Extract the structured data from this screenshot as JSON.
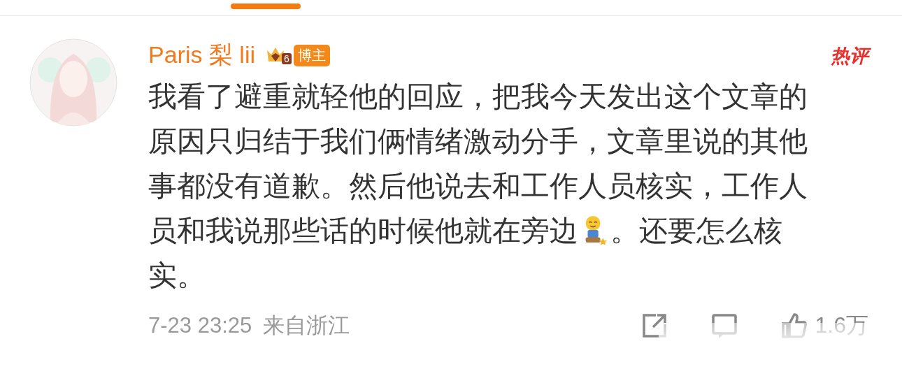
{
  "tab_indicator": {
    "selected": true
  },
  "comment": {
    "author": "Paris 梨 lii",
    "level_badge": "6",
    "role_badge": "博主",
    "hot_tag": "热评",
    "lines": [
      [
        {
          "kind": "text",
          "text": "我看了避重就轻他的回应，把我今天发出这个文章的"
        }
      ],
      [
        {
          "kind": "text",
          "text": "原因只归结于我们俩情绪激动分手，文章里说的其他"
        }
      ],
      [
        {
          "kind": "text",
          "text": "事都没有道歉。然后他说去和工作人员核实，工作人"
        }
      ],
      [
        {
          "kind": "text",
          "text": "员和我说那些话的时候他就在旁边"
        },
        {
          "kind": "emoji"
        },
        {
          "kind": "text",
          "text": "。还要怎么核"
        }
      ],
      [
        {
          "kind": "text",
          "text": "实。"
        }
      ]
    ],
    "time": "7-23 23:25",
    "location": "来自浙江",
    "likes": "1.6万"
  }
}
